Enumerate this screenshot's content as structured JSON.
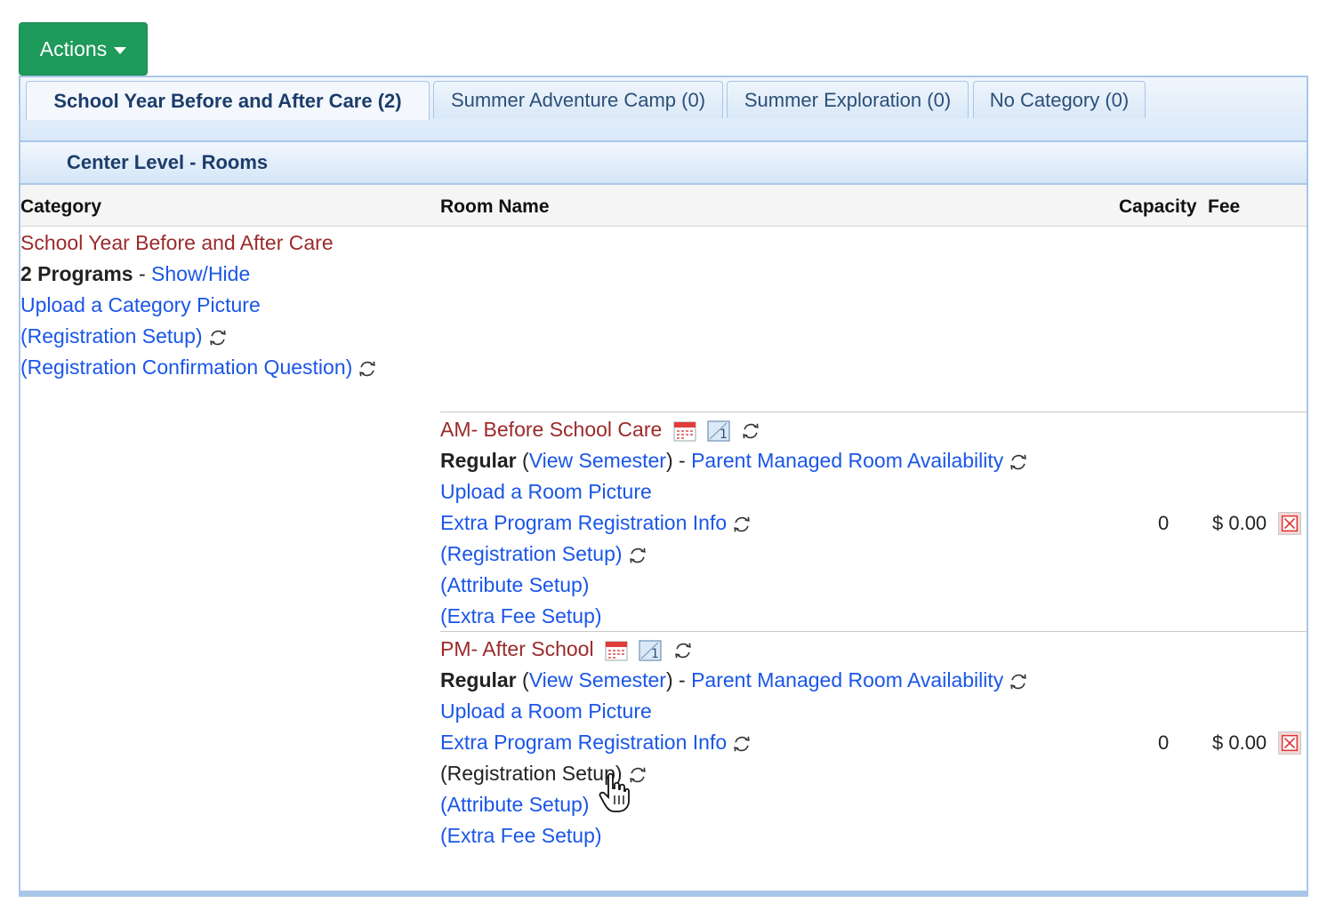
{
  "toolbar": {
    "actions_label": "Actions"
  },
  "tabs": [
    {
      "label": "School Year Before and After Care (2)",
      "active": true
    },
    {
      "label": "Summer Adventure Camp (0)",
      "active": false
    },
    {
      "label": "Summer Exploration (0)",
      "active": false
    },
    {
      "label": "No Category (0)",
      "active": false
    }
  ],
  "section": {
    "title": "Center Level - Rooms"
  },
  "columns": {
    "category": "Category",
    "room_name": "Room Name",
    "capacity": "Capacity",
    "fee": "Fee"
  },
  "category": {
    "name": "School Year Before and After Care",
    "programs_count": "2 Programs",
    "separator": " - ",
    "show_hide": "Show/Hide",
    "upload_picture": "Upload a Category Picture",
    "registration_setup": "(Registration Setup)",
    "confirmation_question": "(Registration Confirmation Question)"
  },
  "rooms": [
    {
      "name": "AM- Before School Care",
      "type": "Regular",
      "open_paren": " (",
      "view_semester": "View Semester",
      "close_dash": ") - ",
      "parent_managed": "Parent Managed Room Availability",
      "upload_picture": "Upload a Room Picture",
      "extra_info": "Extra Program Registration Info",
      "registration_setup": "(Registration Setup)",
      "attribute_setup": "(Attribute Setup)",
      "extra_fee_setup": "(Extra Fee Setup)",
      "capacity": "0",
      "fee": "$ 0.00"
    },
    {
      "name": "PM- After School",
      "type": "Regular",
      "open_paren": " (",
      "view_semester": "View Semester",
      "close_dash": ") - ",
      "parent_managed": "Parent Managed Room Availability",
      "upload_picture": "Upload a Room Picture",
      "extra_info": "Extra Program Registration Info",
      "registration_setup": "(Registration Setup)",
      "attribute_setup": "(Attribute Setup)",
      "extra_fee_setup": "(Extra Fee Setup)",
      "capacity": "0",
      "fee": "$ 0.00"
    }
  ],
  "icons": {
    "sync": "refresh-icon",
    "calendar": "calendar-icon",
    "day": "day-one-icon",
    "delete": "delete-icon",
    "cursor": "hand-pointer-cursor"
  },
  "colors": {
    "actions_bg": "#1e9a5a",
    "link": "#1a56e8",
    "category_name": "#9b2a2a",
    "panel_border": "#a9c6e8",
    "header_text": "#1c3d6b"
  }
}
